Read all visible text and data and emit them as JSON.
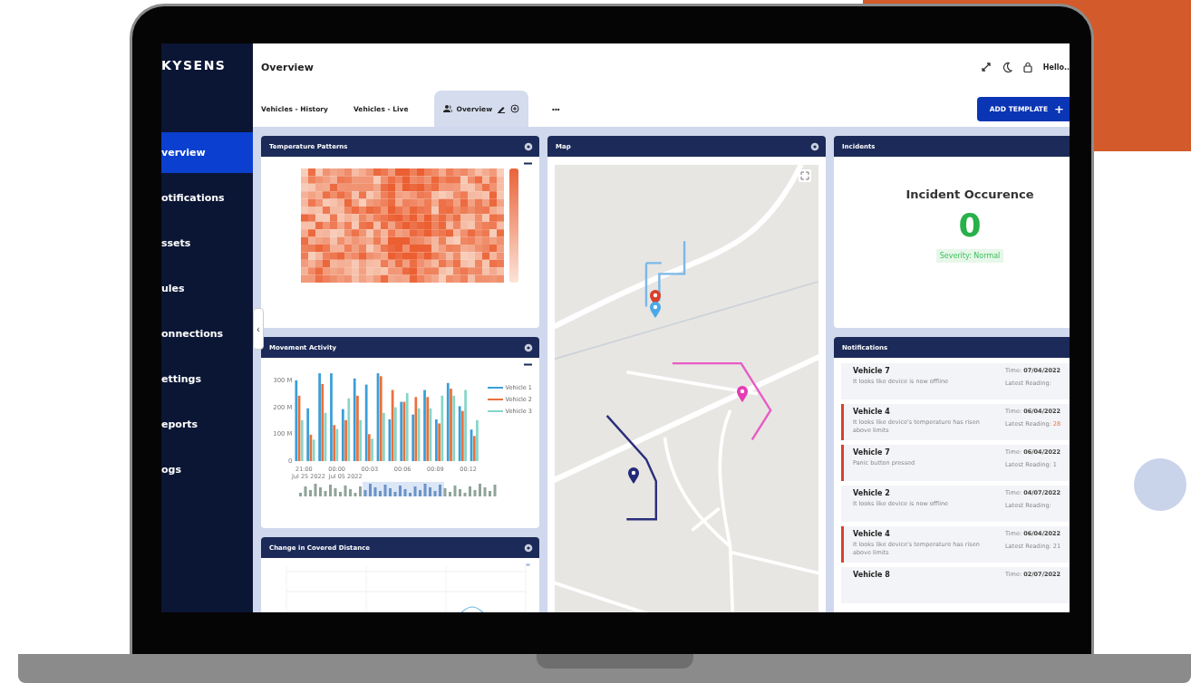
{
  "logo": "KYSENS",
  "sidebar": {
    "items": [
      {
        "label": "verview",
        "selected": true
      },
      {
        "label": "otifications",
        "selected": false
      },
      {
        "label": "ssets",
        "selected": false
      },
      {
        "label": "ules",
        "selected": false
      },
      {
        "label": "onnections",
        "selected": false
      },
      {
        "label": "ettings",
        "selected": false
      },
      {
        "label": "eports",
        "selected": false
      },
      {
        "label": "ogs",
        "selected": false
      }
    ],
    "collapse": "‹"
  },
  "header": {
    "title": "Overview",
    "greeting": "Hello.."
  },
  "tabs": [
    {
      "label": "Vehicles - History",
      "selected": false
    },
    {
      "label": "Vehicles - Live",
      "selected": false
    },
    {
      "label": "Overview",
      "selected": true
    }
  ],
  "more": "•••",
  "add_template": {
    "label": "ADD TEMPLATE",
    "icon": "+"
  },
  "panels": {
    "temperature": {
      "title": "Temperature Patterns"
    },
    "movement": {
      "title": "Movement Activity",
      "x_labels": [
        "21:00",
        "00:00",
        "00:03",
        "00:06",
        "00:09",
        "00:12"
      ],
      "date_labels": [
        "Jul 25 2022",
        "Jul 05 2022"
      ],
      "chart_data": {
        "type": "bar",
        "ylim": [
          0,
          330
        ],
        "yticks": [
          {
            "value": 0,
            "label": "0"
          },
          {
            "value": 100,
            "label": "100 M"
          },
          {
            "value": 200,
            "label": "200 M"
          },
          {
            "value": 300,
            "label": "300 M"
          }
        ],
        "series": [
          {
            "name": "Vehicle 1",
            "color": "#3a9fd8",
            "values": [
              300,
              196,
              326,
              326,
              193,
              307,
              284,
              326,
              155,
              220,
              173,
              264,
              155,
              290,
              204,
              117
            ]
          },
          {
            "name": "Vehicle 2",
            "color": "#e8713c",
            "values": [
              243,
              98,
              286,
              134,
              152,
              243,
              100,
              315,
              264,
              220,
              238,
              238,
              140,
              269,
              186,
              93
            ]
          },
          {
            "name": "Vehicle 3",
            "color": "#86d6c8",
            "values": [
              152,
              80,
              179,
              119,
              233,
              152,
              83,
              179,
              200,
              252,
              196,
              196,
              243,
              243,
              264,
              152
            ]
          }
        ]
      }
    },
    "distance": {
      "title": "Change in Covered Distance"
    },
    "map": {
      "title": "Map"
    },
    "incidents": {
      "title": "Incidents",
      "heading": "Incident Occurence",
      "count": "0",
      "severity": "Severity: Normal"
    },
    "notifications": {
      "title": "Notifications",
      "items": [
        {
          "title": "Vehicle 7",
          "message": "It looks like device is now offline",
          "time_label": "Time:",
          "time": "07/04/2022",
          "reading_label": "Latest Reading:",
          "flagged": false
        },
        {
          "title": "Vehicle 4",
          "message": "It looks like device's temperature has risen above limits",
          "time_label": "Time:",
          "time": "06/04/2022",
          "reading_label": "Latest Reading:",
          "reading": "28",
          "flagged": true
        },
        {
          "title": "Vehicle 7",
          "message": "Panic button pressed",
          "time_label": "Time:",
          "time": "06/04/2022",
          "reading_label": "Latest Reading:",
          "reading": "1",
          "flagged": true
        },
        {
          "title": "Vehicle 2",
          "message": "It looks like device is now offline",
          "time_label": "Time:",
          "time": "04/07/2022",
          "reading_label": "Latest Reading:",
          "flagged": false
        },
        {
          "title": "Vehicle 4",
          "message": "It looks like device's temperature has risen above limits",
          "time_label": "Time:",
          "time": "06/04/2022",
          "reading_label": "Latest Reading:",
          "reading": "21",
          "flagged": true
        },
        {
          "title": "Vehicle 8",
          "time_label": "Time:",
          "time": "02/07/2022",
          "flagged": false
        }
      ]
    }
  }
}
